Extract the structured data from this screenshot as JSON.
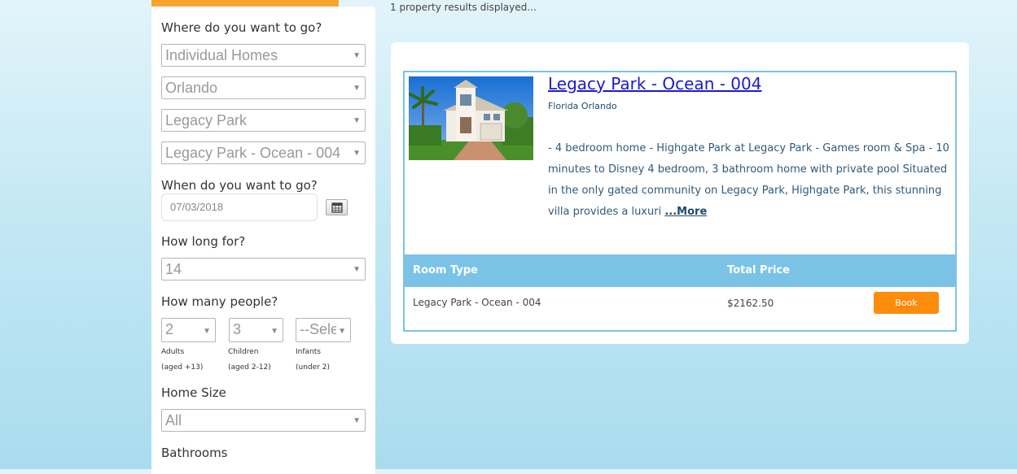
{
  "results": {
    "count_text": "1 property results displayed..."
  },
  "search": {
    "where_label": "Where do you want to go?",
    "property_type": "Individual Homes",
    "city": "Orlando",
    "resort": "Legacy Park",
    "property": "Legacy Park - Ocean - 004",
    "when_label": "When do you want to go?",
    "date_value": "07/03/2018",
    "how_long_label": "How long for?",
    "nights": "14",
    "people_label": "How many people?",
    "adults": {
      "value": "2",
      "label": "Adults",
      "sublabel": "(aged +13)"
    },
    "children": {
      "value": "3",
      "label": "Children",
      "sublabel": "(aged 2-12)"
    },
    "infants": {
      "value": "--Sele",
      "label": "Infants",
      "sublabel": "(under 2)"
    },
    "home_size_label": "Home Size",
    "home_size": "All",
    "bathrooms_label": "Bathrooms"
  },
  "listing": {
    "title": "Legacy Park - Ocean - 004",
    "location": "Florida Orlando",
    "description": "- 4 bedroom home - Highgate Park at Legacy Park - Games room & Spa - 10 minutes to Disney 4 bedroom, 3 bathroom home with private pool Situated in the only gated community on Legacy Park, Highgate Park, this stunning villa provides a luxuri",
    "more_label": "...More",
    "table": {
      "col_room_type": "Room Type",
      "col_total_price": "Total Price",
      "rows": [
        {
          "room_type": "Legacy Park - Ocean - 004",
          "price": "$2162.50",
          "book_label": "Book"
        }
      ]
    }
  },
  "colors": {
    "accent_orange": "#fd8b0c",
    "header_blue": "#7ac3e7",
    "link_blue": "#1a1ad0"
  },
  "icons": {
    "calendar": "calendar-icon",
    "dropdown": "chevron-down-icon"
  }
}
